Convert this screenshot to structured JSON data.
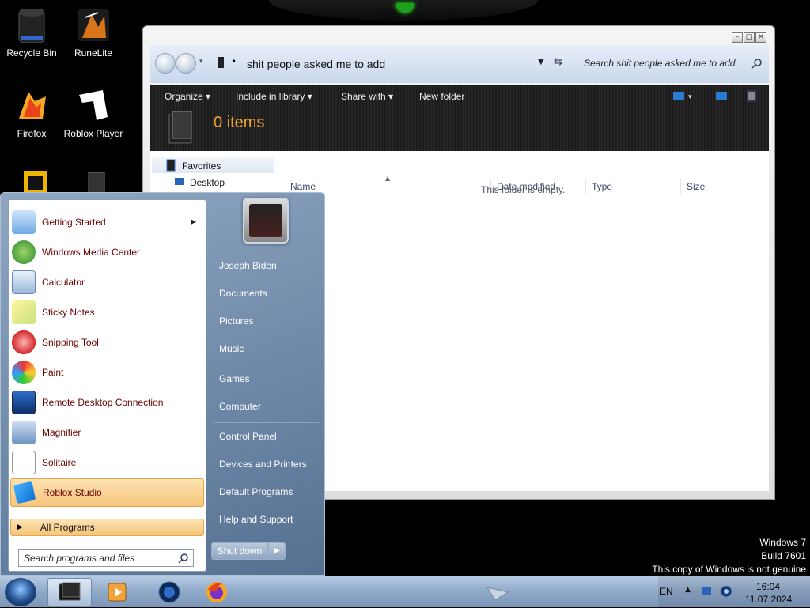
{
  "desktop": {
    "icons": [
      {
        "label": "Recycle Bin",
        "icon": "recycle-bin-icon"
      },
      {
        "label": "RuneLite",
        "icon": "runelite-icon"
      },
      {
        "label": "Firefox",
        "icon": "firefox-icon"
      },
      {
        "label": "Roblox Player",
        "icon": "roblox-player-icon"
      }
    ]
  },
  "explorer": {
    "path": "shit people asked me to add",
    "search_placeholder": "Search shit people asked me to add",
    "toolbar": {
      "organize": "Organize",
      "include_in_library": "Include in library",
      "share_with": "Share with",
      "new_folder": "New folder"
    },
    "item_count": "0 items",
    "columns": [
      "Name",
      "Date modified",
      "Type",
      "Size"
    ],
    "empty_message": "This folder is empty.",
    "nav": {
      "favorites": "Favorites",
      "desktop": "Desktop"
    }
  },
  "start_menu": {
    "programs": [
      {
        "label": "Getting Started",
        "icon": "getting-started-icon",
        "has_submenu": true
      },
      {
        "label": "Windows Media Center",
        "icon": "windows-media-center-icon"
      },
      {
        "label": "Calculator",
        "icon": "calculator-icon"
      },
      {
        "label": "Sticky Notes",
        "icon": "sticky-notes-icon"
      },
      {
        "label": "Snipping Tool",
        "icon": "snipping-tool-icon"
      },
      {
        "label": "Paint",
        "icon": "paint-icon"
      },
      {
        "label": "Remote Desktop Connection",
        "icon": "remote-desktop-icon"
      },
      {
        "label": "Magnifier",
        "icon": "magnifier-icon"
      },
      {
        "label": "Solitaire",
        "icon": "solitaire-icon"
      },
      {
        "label": "Roblox Studio",
        "icon": "roblox-studio-icon",
        "highlighted": true
      }
    ],
    "all_programs": "All Programs",
    "search_placeholder": "Search programs and files",
    "user_name": "Joseph Biden",
    "right_items": [
      "Documents",
      "Pictures",
      "Music",
      "Games",
      "Computer",
      "Control Panel",
      "Devices and Printers",
      "Default Programs",
      "Help and Support"
    ],
    "shutdown": "Shut down"
  },
  "watermark": {
    "line1": "Windows 7",
    "line2": "Build 7601",
    "line3": "This copy of Windows is not genuine"
  },
  "taskbar": {
    "language": "EN",
    "time": "16:04",
    "date": "11.07.2024"
  },
  "colors": {
    "accent": "#f0a030",
    "program_text": "#6a0000",
    "highlight": "#f6c57a"
  }
}
